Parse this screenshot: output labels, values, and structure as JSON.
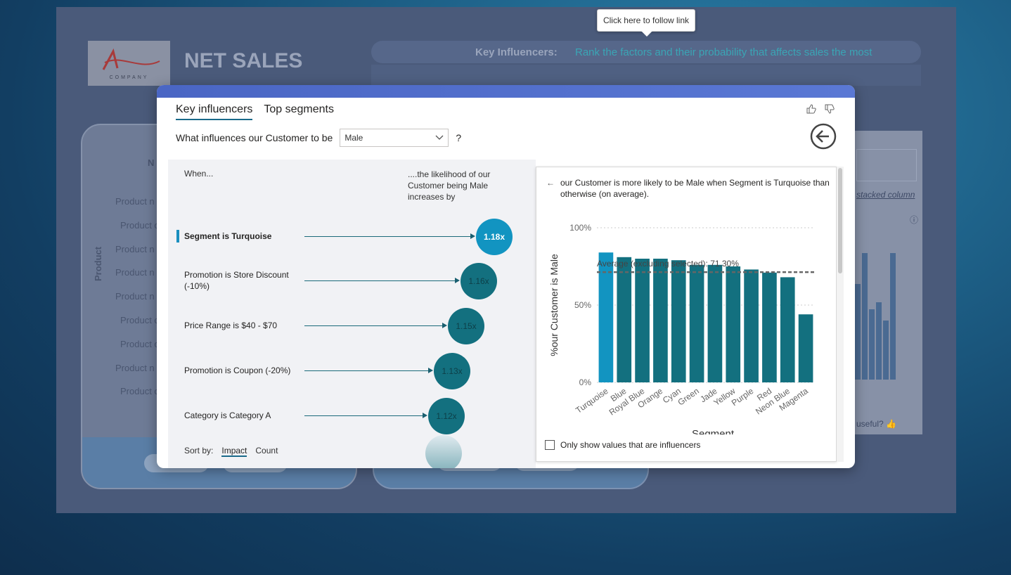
{
  "background": {
    "logo_text": "COMPANY",
    "title": "NET SALES",
    "key_influencers_label": "Key Influencers:",
    "key_influencers_text": "Rank the factors and their probability that affects sales the most",
    "tooltip": "Click here to follow link",
    "product_axis": "Product",
    "product_rows": [
      "Product n",
      "Product c",
      "Product n",
      "Product n",
      "Product n",
      "Product c",
      "Product c",
      "Product n",
      "Product c"
    ],
    "right_card_link": "stacked column",
    "right_card_useful": "useful?",
    "left_card_partial": "N"
  },
  "modal": {
    "tabs": [
      {
        "label": "Key influencers",
        "active": true
      },
      {
        "label": "Top segments",
        "active": false
      }
    ],
    "question_prefix": "What influences our Customer to be",
    "question_value": "Male",
    "question_suffix": "?",
    "when_label": "When...",
    "likelihood_label": "....the likelihood of our Customer being Male increases by",
    "influencers": [
      {
        "label": "Segment is Turquoise",
        "value": "1.18x",
        "selected": true
      },
      {
        "label": "Promotion is Store Discount (-10%)",
        "value": "1.16x",
        "selected": false
      },
      {
        "label": "Price Range is $40 - $70",
        "value": "1.15x",
        "selected": false
      },
      {
        "label": "Promotion is Coupon (-20%)",
        "value": "1.13x",
        "selected": false
      },
      {
        "label": "Category is Category A",
        "value": "1.12x",
        "selected": false
      }
    ],
    "sort_by_label": "Sort by:",
    "sort_options": [
      "Impact",
      "Count"
    ],
    "detail_text": "our Customer is more likely to be Male when Segment is Turquoise than otherwise (on average).",
    "only_show_label": "Only show values that are influencers",
    "colors": {
      "selected": "#1294c1",
      "bar": "#13707f",
      "header": "#4a66c4"
    }
  },
  "chart_data": {
    "type": "bar",
    "categories": [
      "Turquoise",
      "Blue",
      "Royal Blue",
      "Orange",
      "Cyan",
      "Green",
      "Jade",
      "Yellow",
      "Purple",
      "Red",
      "Neon Blue",
      "Magenta"
    ],
    "values": [
      84,
      81,
      80,
      80,
      79,
      76,
      76,
      75,
      73,
      71,
      68,
      44
    ],
    "highlight": "Turquoise",
    "average_label": "Average (excluding selected): 71.30%",
    "average": 71.3,
    "xlabel": "Segment",
    "ylabel": "%our Customer is Male",
    "yticks": [
      "0%",
      "50%",
      "100%"
    ],
    "ylim": [
      0,
      100
    ]
  }
}
